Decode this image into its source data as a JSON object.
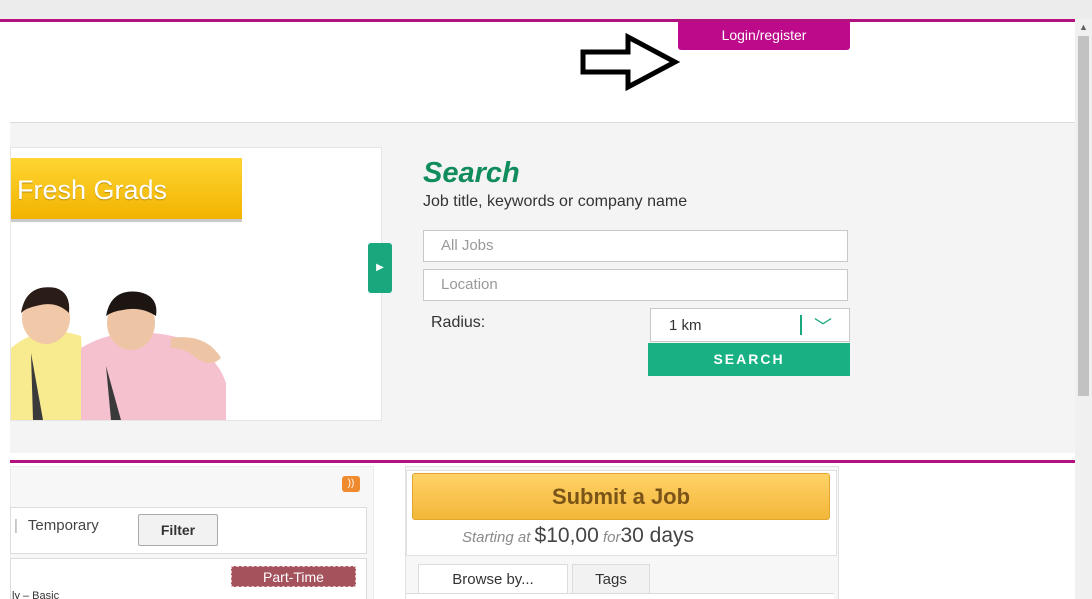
{
  "header": {
    "login_label": "Login/register",
    "arrow_icon": "arrow-right-outline-icon"
  },
  "banner": {
    "label": "Fresh Grads",
    "slider_icon": "play-right-icon"
  },
  "search": {
    "title": "Search",
    "subtitle": "Job title, keywords or company name",
    "jobs_placeholder": "All Jobs",
    "location_placeholder": "Location",
    "radius_label": "Radius:",
    "radius_value": "1 km",
    "button_label": "SEARCH"
  },
  "listing": {
    "rss_icon": "rss-icon",
    "type_label": "Temporary",
    "filter_label": "Filter",
    "badge": "Part-Time",
    "snippet": "ly  – Basic"
  },
  "submit": {
    "button_label": "Submit a Job",
    "starting_at": "Starting at",
    "price": "$10,00",
    "for_label": "for",
    "days": "30 days"
  },
  "tabs": [
    "Browse by...",
    "Tags"
  ],
  "colors": {
    "brand": "#bd0a8a",
    "accent": "#19b183",
    "submit": "#f3b73a"
  }
}
